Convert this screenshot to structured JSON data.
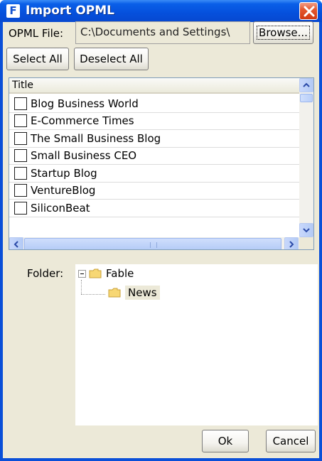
{
  "window": {
    "title": "Import OPML",
    "app_icon_letter": "F"
  },
  "file_row": {
    "label": "OPML File:",
    "path": "C:\\Documents and Settings\\",
    "browse_label": "Browse..."
  },
  "select_buttons": {
    "select_all": "Select All",
    "deselect_all": "Deselect All"
  },
  "feed_list": {
    "column_header": "Title",
    "items": [
      {
        "title": "Blog Business World",
        "checked": false
      },
      {
        "title": "E-Commerce Times",
        "checked": false
      },
      {
        "title": "The Small Business Blog",
        "checked": false
      },
      {
        "title": "Small Business CEO",
        "checked": false
      },
      {
        "title": "Startup Blog",
        "checked": false
      },
      {
        "title": "VentureBlog",
        "checked": false
      },
      {
        "title": "SiliconBeat",
        "checked": false
      }
    ]
  },
  "folder": {
    "label": "Folder:",
    "tree": [
      {
        "label": "Fable",
        "expanded": true
      },
      {
        "label": "News",
        "selected": true
      }
    ]
  },
  "actions": {
    "ok": "Ok",
    "cancel": "Cancel"
  },
  "colors": {
    "titlebar": "#0550dc",
    "dialog_bg": "#ece9d8",
    "close_button": "#d23a12",
    "scrollbar": "#b8cef8"
  }
}
